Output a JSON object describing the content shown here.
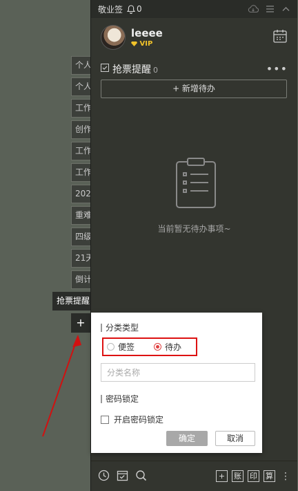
{
  "side_tabs": [
    {
      "label": "个人"
    },
    {
      "label": "个人"
    },
    {
      "label": "工作"
    },
    {
      "label": "创作"
    },
    {
      "label": "工作"
    },
    {
      "label": "工作"
    },
    {
      "label": "202"
    },
    {
      "label": "重难"
    },
    {
      "label": "四级"
    },
    {
      "label": "21天"
    },
    {
      "label": "倒计"
    }
  ],
  "active_tab": {
    "label": "抢票提醒"
  },
  "add_tab": {
    "label": "+"
  },
  "titlebar": {
    "app_name": "敬业签",
    "bell_count": "0"
  },
  "user": {
    "name": "leeee",
    "badge": "VIP"
  },
  "section": {
    "title": "抢票提醒",
    "count": "0",
    "more": "•••"
  },
  "new_todo": {
    "label": "+ 新增待办"
  },
  "empty": {
    "text": "当前暂无待办事项~"
  },
  "popup": {
    "category_type_label": "分类类型",
    "radio_options": [
      {
        "label": "便签",
        "checked": false
      },
      {
        "label": "待办",
        "checked": true
      }
    ],
    "name_placeholder": "分类名称",
    "lock_label": "密码锁定",
    "lock_checkbox_label": "开启密码锁定",
    "confirm_label": "确定",
    "cancel_label": "取消"
  },
  "bottom": {
    "buttons": [
      {
        "label": "+"
      },
      {
        "label": "账"
      },
      {
        "label": "印"
      },
      {
        "label": "算"
      }
    ],
    "more": "⋮"
  },
  "colors": {
    "annotation_red": "#d11111",
    "panel_bg": "#33352f",
    "vip_gold": "#f0c22a"
  }
}
